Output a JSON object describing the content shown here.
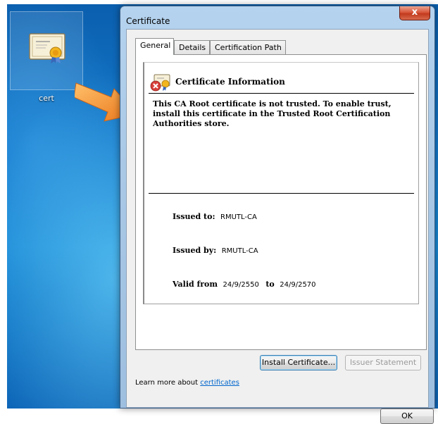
{
  "desktop": {
    "icon_label": "cert",
    "icon_name": "certificate-file-icon"
  },
  "window": {
    "title": "Certificate",
    "close_label": "x",
    "tabs": [
      {
        "label": "General",
        "active": true
      },
      {
        "label": "Details",
        "active": false
      },
      {
        "label": "Certification Path",
        "active": false
      }
    ],
    "info_title": "Certificate Information",
    "warning": "This CA Root certificate is not trusted. To enable trust, install this certificate in the Trusted Root Certification Authorities store.",
    "issued_to_label": "Issued to:",
    "issued_to_value": "RMUTL-CA",
    "issued_by_label": "Issued by:",
    "issued_by_value": "RMUTL-CA",
    "valid_from_label": "Valid from",
    "valid_from_value": "24/9/2550",
    "valid_to_label": "to",
    "valid_to_value": "24/9/2570",
    "install_button": "Install Certificate...",
    "issuer_button": "Issuer Statement",
    "learn_text": "Learn more about ",
    "learn_link": "certificates",
    "ok_button": "OK"
  },
  "colors": {
    "arrow": "#f08a24",
    "link": "#0066cc",
    "close": "#c23a1e"
  }
}
